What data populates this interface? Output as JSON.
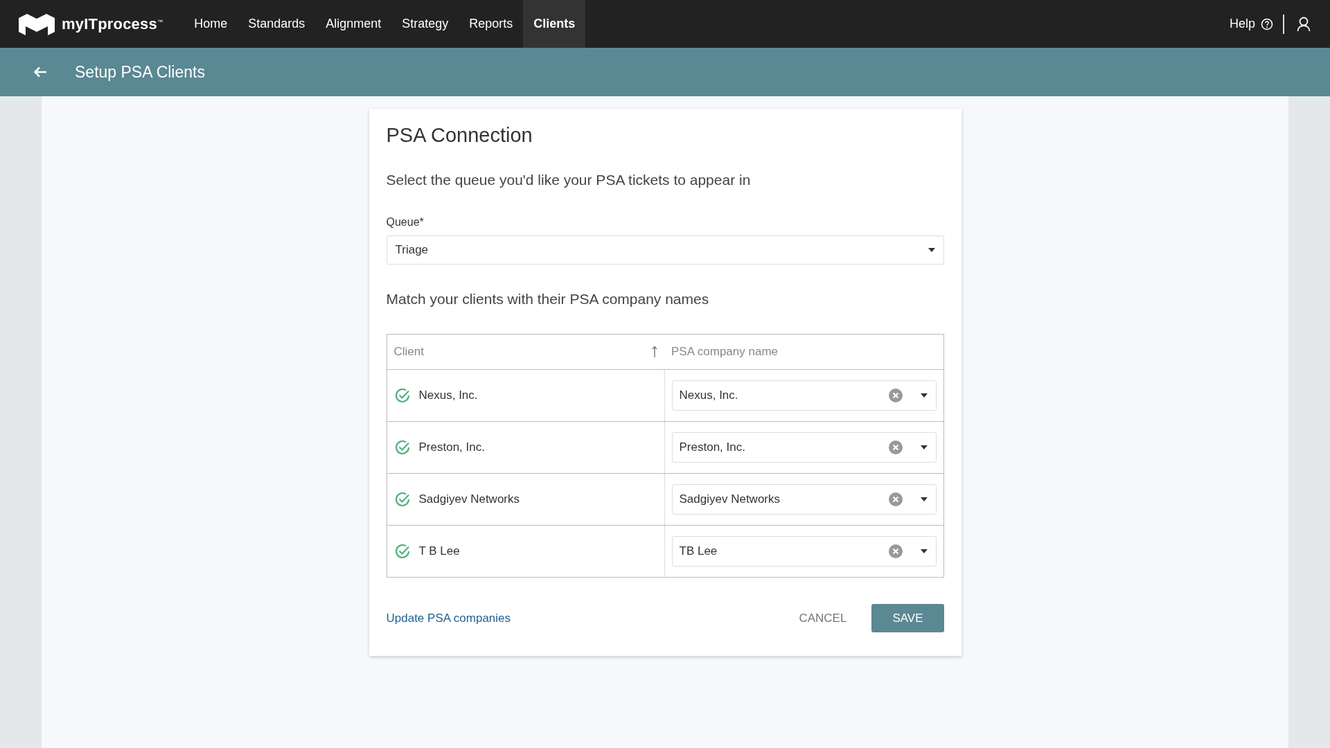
{
  "logo": {
    "text": "myITprocess$^{™}$"
  },
  "nav": [
    {
      "label": "Home",
      "selected": false
    },
    {
      "label": "Standards",
      "selected": false
    },
    {
      "label": "Alignment",
      "selected": false
    },
    {
      "label": "Strategy",
      "selected": false
    },
    {
      "label": "Reports",
      "selected": false
    },
    {
      "label": "Clients",
      "selected": true
    }
  ],
  "help": "Help",
  "subheader": {
    "title": "Setup PSA Clients"
  },
  "card": {
    "title": "PSA Connection",
    "queue_prompt": "Select the queue you'd like your PSA tickets to appear in",
    "queue": {
      "label": "Queue*",
      "value": "Triage"
    },
    "match_prompt": "Match your clients with their PSA company names",
    "table": {
      "columns": [
        {
          "label": "Client",
          "sorted": true
        },
        {
          "label": "PSA company name",
          "sorted": false
        }
      ],
      "rows": [
        {
          "client": "Nexus, Inc.",
          "matched": true,
          "psa_company": "Nexus, Inc."
        },
        {
          "client": "Preston, Inc.",
          "matched": true,
          "psa_company": "Preston, Inc."
        },
        {
          "client": "Sadgiyev Networks",
          "matched": true,
          "psa_company": "Sadgiyev Networks"
        },
        {
          "client": "T B Lee",
          "matched": true,
          "psa_company": "TB Lee"
        }
      ]
    },
    "link": "Update PSA companies",
    "buttons": [
      {
        "label": "CANCEL",
        "kind": "text"
      },
      {
        "label": "SAVE",
        "kind": "primary"
      }
    ]
  }
}
